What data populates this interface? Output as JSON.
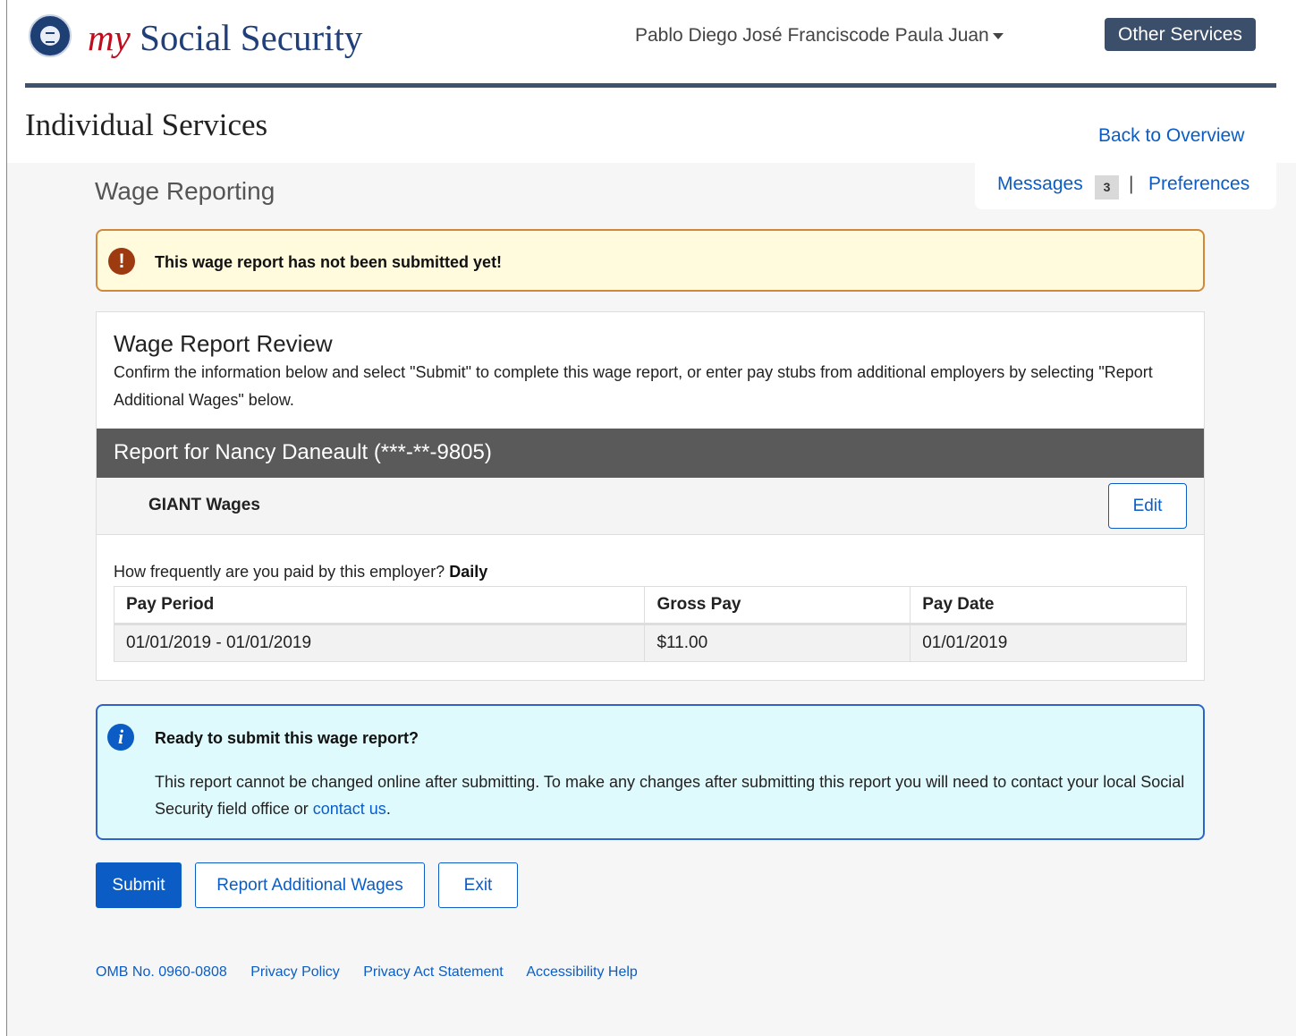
{
  "header": {
    "brand_my": "my",
    "brand_rest": "Social Security",
    "user_name": "Pablo Diego José Franciscode Paula Juan",
    "other_services": "Other Services",
    "page_title": "Individual Services",
    "back_link": "Back to Overview",
    "messages_label": "Messages",
    "messages_count": "3",
    "separator": "|",
    "preferences": "Preferences"
  },
  "section_title": "Wage Reporting",
  "warning": {
    "icon": "!",
    "text": "This wage report has not been submitted yet!"
  },
  "review": {
    "title": "Wage Report Review",
    "description": "Confirm the information below and select \"Submit\" to complete this wage report, or enter pay stubs from additional employers by selecting \"Report Additional Wages\" below.",
    "report_for": "Report for Nancy Daneault (***-**-9805)",
    "employer": "GIANT Wages",
    "edit_label": "Edit",
    "frequency_question": "How frequently are you paid by this employer?",
    "frequency_value": "Daily",
    "columns": [
      "Pay Period",
      "Gross Pay",
      "Pay Date"
    ],
    "rows": [
      [
        "01/01/2019 - 01/01/2019",
        "$11.00",
        "01/01/2019"
      ]
    ]
  },
  "info": {
    "icon": "i",
    "title": "Ready to submit this wage report?",
    "body": "This report cannot be changed online after submitting. To make any changes after submitting this report you will need to contact your local Social Security field office or",
    "link": "contact us",
    "end": "."
  },
  "actions": {
    "submit": "Submit",
    "additional": "Report Additional Wages",
    "exit": "Exit"
  },
  "footer": {
    "omb": "OMB No. 0960-0808",
    "privacy_policy": "Privacy Policy",
    "privacy_act": "Privacy Act Statement",
    "accessibility": "Accessibility Help"
  },
  "colors": {
    "brand_red": "#c00d1e",
    "brand_blue": "#213f78",
    "link_blue": "#0b5dc5",
    "warning_bg": "#fffbdc",
    "info_bg": "#dffafd"
  }
}
